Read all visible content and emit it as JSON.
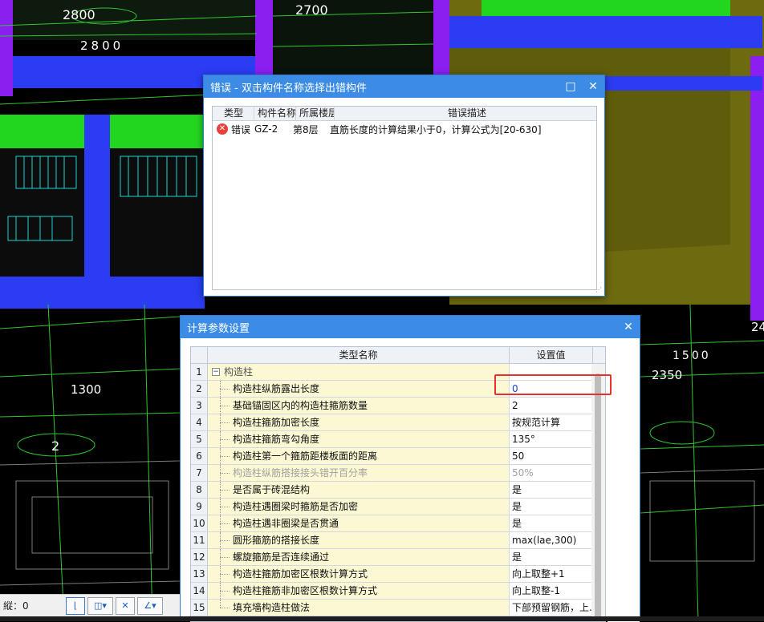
{
  "cad": {
    "labels": [
      "2800",
      "2800",
      "2700",
      "1300",
      "2350",
      "1500",
      "2",
      "24"
    ]
  },
  "error_dialog": {
    "title": "错误 - 双击构件名称选择出错构件",
    "columns": [
      "类型",
      "构件名称",
      "所属楼层",
      "错误描述"
    ],
    "rows": [
      {
        "type": "错误",
        "name": "GZ-2",
        "floor": "第8层",
        "desc": "直筋长度的计算结果小于0，计算公式为[20-630]"
      }
    ],
    "maximize_icon": "□",
    "close_icon": "✕"
  },
  "param_dialog": {
    "title": "计算参数设置",
    "close_icon": "✕",
    "columns": [
      "类型名称",
      "设置值"
    ],
    "group": {
      "num": "1",
      "name": "构造柱",
      "toggle": "−"
    },
    "rows": [
      {
        "num": "2",
        "name": "构造柱纵筋露出长度",
        "value": "0"
      },
      {
        "num": "3",
        "name": "基础锚固区内的构造柱箍筋数量",
        "value": "2"
      },
      {
        "num": "4",
        "name": "构造柱箍筋加密长度",
        "value": "按规范计算"
      },
      {
        "num": "5",
        "name": "构造柱箍筋弯勾角度",
        "value": "135°"
      },
      {
        "num": "6",
        "name": "构造柱第一个箍筋距楼板面的距离",
        "value": "50"
      },
      {
        "num": "7",
        "name": "构造柱纵筋搭接接头错开百分率",
        "value": "50%"
      },
      {
        "num": "8",
        "name": "是否属于砖混结构",
        "value": "是"
      },
      {
        "num": "9",
        "name": "构造柱遇圈梁时箍筋是否加密",
        "value": "是"
      },
      {
        "num": "10",
        "name": "构造柱遇非圈梁是否贯通",
        "value": "是"
      },
      {
        "num": "11",
        "name": "圆形箍筋的搭接长度",
        "value": "max(lae,300)"
      },
      {
        "num": "12",
        "name": "螺旋箍筋是否连续通过",
        "value": "是"
      },
      {
        "num": "13",
        "name": "构造柱箍筋加密区根数计算方式",
        "value": "向上取整+1"
      },
      {
        "num": "14",
        "name": "构造柱箍筋非加密区根数计算方式",
        "value": "向上取整-1"
      },
      {
        "num": "15",
        "name": "填充墙构造柱做法",
        "value": "下部预留钢筋，上..."
      }
    ]
  },
  "statusbar": {
    "label": "縦：0"
  },
  "colors": {
    "accent": "#3c8ce6",
    "cad_green": "#22d61f",
    "cad_blue": "#2b3cf2",
    "cad_purple": "#8b1ff0",
    "cad_olive": "#6d6a10",
    "highlight": "#e8312c"
  }
}
